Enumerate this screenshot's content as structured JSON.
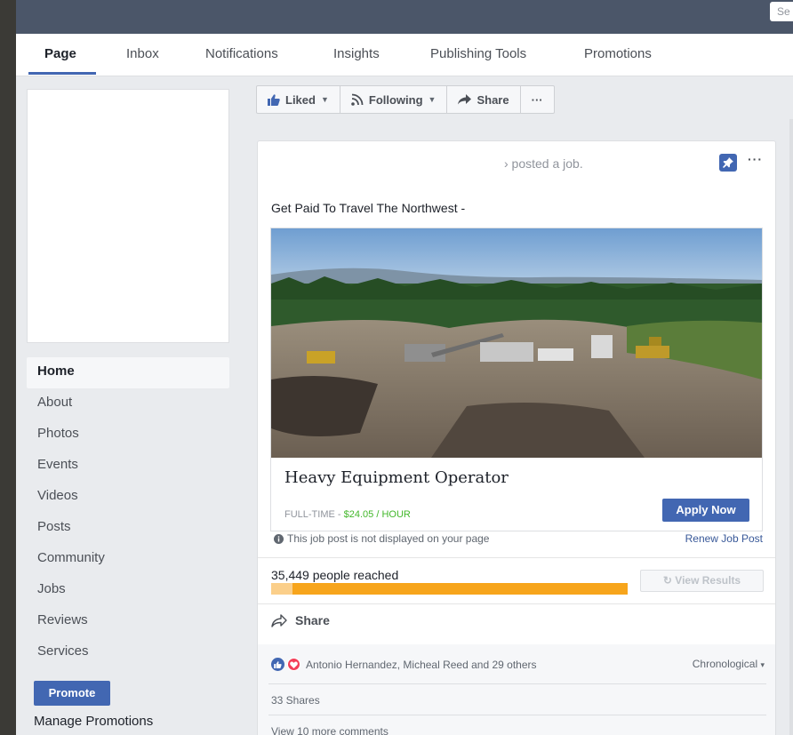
{
  "topbar": {
    "search_placeholder": "Se"
  },
  "tabs": [
    {
      "label": "Page",
      "active": true
    },
    {
      "label": "Inbox"
    },
    {
      "label": "Notifications"
    },
    {
      "label": "Insights"
    },
    {
      "label": "Publishing Tools"
    },
    {
      "label": "Promotions"
    }
  ],
  "actions": {
    "liked": "Liked",
    "following": "Following",
    "share": "Share",
    "more": "···"
  },
  "sidebar": {
    "items": [
      {
        "label": "Home",
        "active": true
      },
      {
        "label": "About"
      },
      {
        "label": "Photos"
      },
      {
        "label": "Events"
      },
      {
        "label": "Videos"
      },
      {
        "label": "Posts"
      },
      {
        "label": "Community"
      },
      {
        "label": "Jobs"
      },
      {
        "label": "Reviews"
      },
      {
        "label": "Services"
      }
    ],
    "promote_label": "Promote",
    "manage_promotions": "Manage Promotions"
  },
  "post": {
    "posted_text": "› posted a job.",
    "text": "Get Paid To Travel The Northwest -",
    "job": {
      "title": "Heavy Equipment Operator",
      "type": "FULL-TIME - ",
      "pay": "$24.05 / HOUR",
      "apply_label": "Apply Now"
    },
    "notice": "This job post is not displayed on your page",
    "renew_label": "Renew Job Post",
    "reach": {
      "label": "35,449 people reached",
      "progress_fraction": 1.0,
      "view_results_label": "View Results"
    },
    "share_label": "Share",
    "reactions": {
      "names": "Antonio Hernandez, Micheal Reed and 29 others",
      "sort_label": "Chronological",
      "shares": "33 Shares",
      "more_comments": "View 10 more comments"
    }
  },
  "colors": {
    "brand": "#4267b2",
    "topbar": "#4b5669",
    "pay_green": "#42b72a",
    "reach_orange": "#f7a51c"
  }
}
